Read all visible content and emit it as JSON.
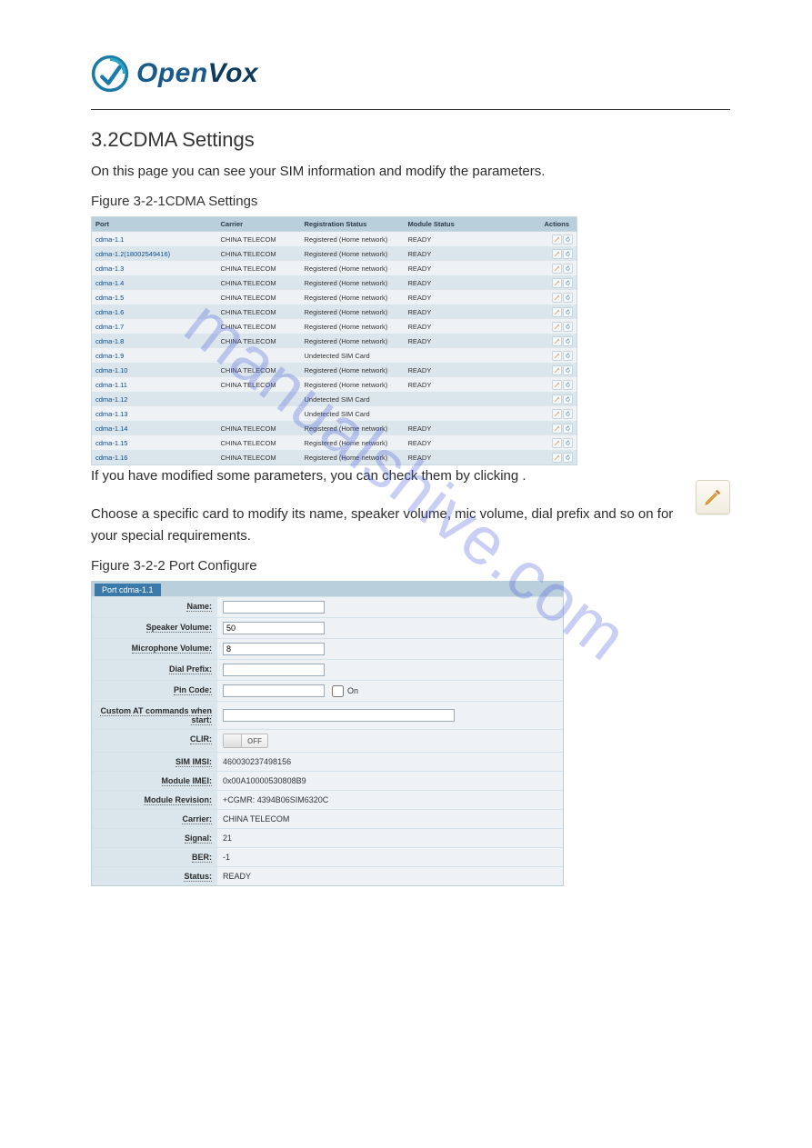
{
  "brand": {
    "name_open": "Open",
    "name_vox": "Vox"
  },
  "watermark": "manualshive.com",
  "section": {
    "heading": "3.2CDMA Settings",
    "para1": "On this page you can see your SIM information and modify the parameters.",
    "para2_a": "If you have modified some parameters, you can check them by clicking ",
    "para2_b": ".",
    "para3": "Choose a specific card to modify its name, speaker volume, mic volume, dial prefix and so on for your special requirements.",
    "fig1": "Figure 3-2-1CDMA Settings",
    "fig2": "Figure 3-2-2 Port Configure"
  },
  "status_table": {
    "headers": {
      "port": "Port",
      "carrier": "Carrier",
      "reg": "Registration Status",
      "mod": "Module Status",
      "actions": "Actions"
    },
    "rows": [
      {
        "port": "cdma-1.1",
        "carrier": "CHINA TELECOM",
        "reg": "Registered (Home network)",
        "mod": "READY"
      },
      {
        "port": "cdma-1.2(18002549416)",
        "carrier": "CHINA TELECOM",
        "reg": "Registered (Home network)",
        "mod": "READY"
      },
      {
        "port": "cdma-1.3",
        "carrier": "CHINA TELECOM",
        "reg": "Registered (Home network)",
        "mod": "READY"
      },
      {
        "port": "cdma-1.4",
        "carrier": "CHINA TELECOM",
        "reg": "Registered (Home network)",
        "mod": "READY"
      },
      {
        "port": "cdma-1.5",
        "carrier": "CHINA TELECOM",
        "reg": "Registered (Home network)",
        "mod": "READY"
      },
      {
        "port": "cdma-1.6",
        "carrier": "CHINA TELECOM",
        "reg": "Registered (Home network)",
        "mod": "READY"
      },
      {
        "port": "cdma-1.7",
        "carrier": "CHINA TELECOM",
        "reg": "Registered (Home network)",
        "mod": "READY"
      },
      {
        "port": "cdma-1.8",
        "carrier": "CHINA TELECOM",
        "reg": "Registered (Home network)",
        "mod": "READY"
      },
      {
        "port": "cdma-1.9",
        "carrier": "",
        "reg": "Undetected SIM Card",
        "mod": ""
      },
      {
        "port": "cdma-1.10",
        "carrier": "CHINA TELECOM",
        "reg": "Registered (Home network)",
        "mod": "READY"
      },
      {
        "port": "cdma-1.11",
        "carrier": "CHINA TELECOM",
        "reg": "Registered (Home network)",
        "mod": "READY"
      },
      {
        "port": "cdma-1.12",
        "carrier": "",
        "reg": "Undetected SIM Card",
        "mod": ""
      },
      {
        "port": "cdma-1.13",
        "carrier": "",
        "reg": "Undetected SIM Card",
        "mod": ""
      },
      {
        "port": "cdma-1.14",
        "carrier": "CHINA TELECOM",
        "reg": "Registered (Home network)",
        "mod": "READY"
      },
      {
        "port": "cdma-1.15",
        "carrier": "CHINA TELECOM",
        "reg": "Registered (Home network)",
        "mod": "READY"
      },
      {
        "port": "cdma-1.16",
        "carrier": "CHINA TELECOM",
        "reg": "Registered (Home network)",
        "mod": "READY"
      }
    ]
  },
  "port_panel": {
    "tab": "Port cdma-1.1",
    "labels": {
      "name": "Name:",
      "speaker": "Speaker Volume:",
      "mic": "Microphone Volume:",
      "dial": "Dial Prefix:",
      "pin": "Pin Code:",
      "pin_on": "On",
      "at": "Custom AT commands when start:",
      "clir": "CLIR:",
      "clir_off": "OFF",
      "imsi": "SIM IMSI:",
      "imei": "Module IMEI:",
      "rev": "Module Revision:",
      "carrier": "Carrier:",
      "signal": "Signal:",
      "ber": "BER:",
      "status": "Status:"
    },
    "values": {
      "name": "",
      "speaker": "50",
      "mic": "8",
      "dial": "",
      "pin": "",
      "at": "",
      "imsi": "460030237498156",
      "imei": "0x00A10000530808B9",
      "rev": "+CGMR: 4394B06SIM6320C",
      "carrier": "CHINA TELECOM",
      "signal": "21",
      "ber": "-1",
      "status": "READY"
    }
  }
}
